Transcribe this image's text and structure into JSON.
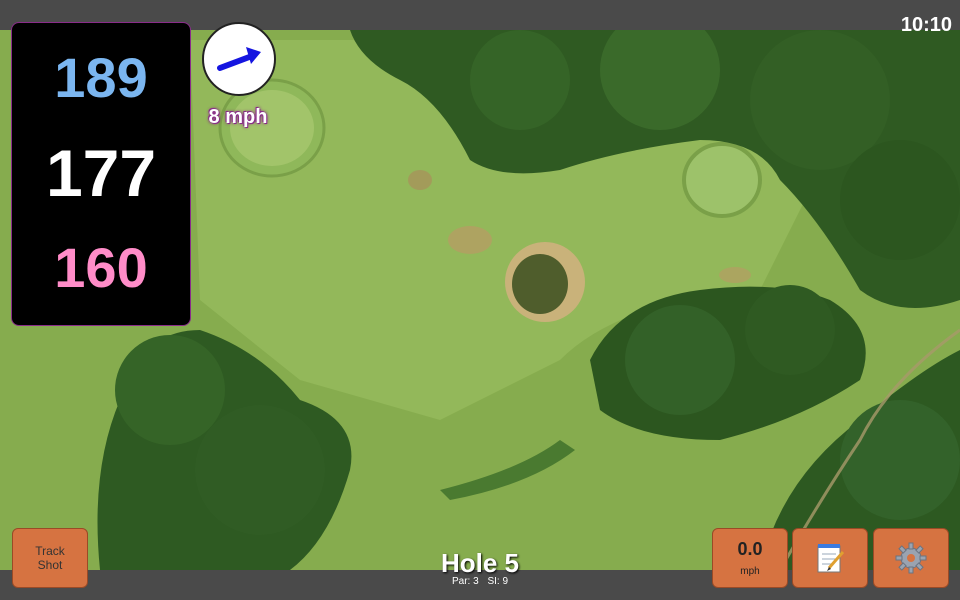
{
  "status_bar": {
    "time": "10:10"
  },
  "distances": {
    "back": "189",
    "middle": "177",
    "front": "160"
  },
  "wind": {
    "speed_label": "8 mph",
    "icon": "wind-arrow-icon"
  },
  "buttons": {
    "track_shot_line1": "Track",
    "track_shot_line2": "Shot",
    "speed_value": "0.0",
    "speed_unit": "mph",
    "notes_icon": "notepad-icon",
    "settings_icon": "gear-icon"
  },
  "hole": {
    "title": "Hole 5",
    "par_label": "Par: 3",
    "si_label": "SI: 9"
  },
  "colors": {
    "back_distance": "#7bb6f0",
    "middle_distance": "#ffffff",
    "front_distance": "#ff8cc8",
    "button_orange": "#d67341",
    "wind_arrow": "#1515e0"
  }
}
